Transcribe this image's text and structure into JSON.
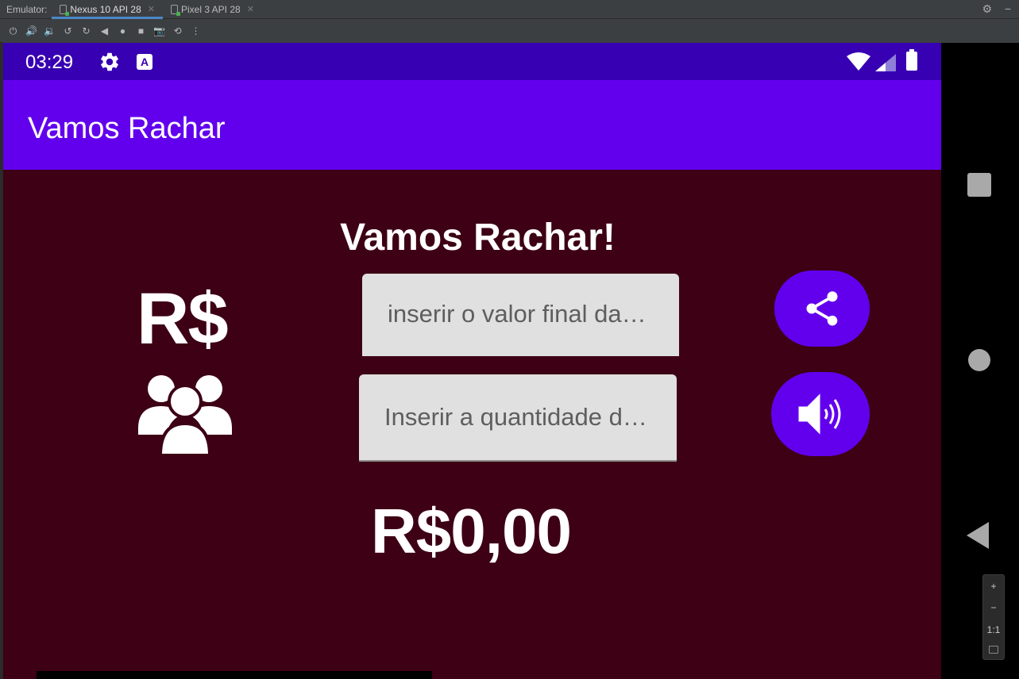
{
  "emulator": {
    "label": "Emulator:",
    "tabs": [
      {
        "label": "Nexus 10 API 28",
        "active": true
      },
      {
        "label": "Pixel 3 API 28",
        "active": false
      }
    ],
    "toolbar_icons": [
      "power-icon",
      "volume-up-icon",
      "volume-down-icon",
      "rotate-left-icon",
      "rotate-right-icon",
      "back-icon",
      "home-icon",
      "overview-icon",
      "screenshot-icon",
      "snapshot-icon",
      "more-icon"
    ],
    "zoom": {
      "plus": "+",
      "minus": "−",
      "actual": "1:1"
    }
  },
  "statusbar": {
    "time": "03:29"
  },
  "appbar": {
    "title": "Vamos Rachar"
  },
  "main": {
    "heading": "Vamos Rachar!",
    "currency_symbol": "R$",
    "value_input": {
      "placeholder": "inserir o valor final da…",
      "value": ""
    },
    "people_input": {
      "placeholder": "Inserir a quantidade d…",
      "value": ""
    },
    "result": "R$0,00"
  },
  "colors": {
    "statusbar": "#3700b3",
    "appbar": "#6200ee",
    "background": "#3d0014",
    "fab": "#6200ee",
    "field": "#e0e0e0"
  }
}
